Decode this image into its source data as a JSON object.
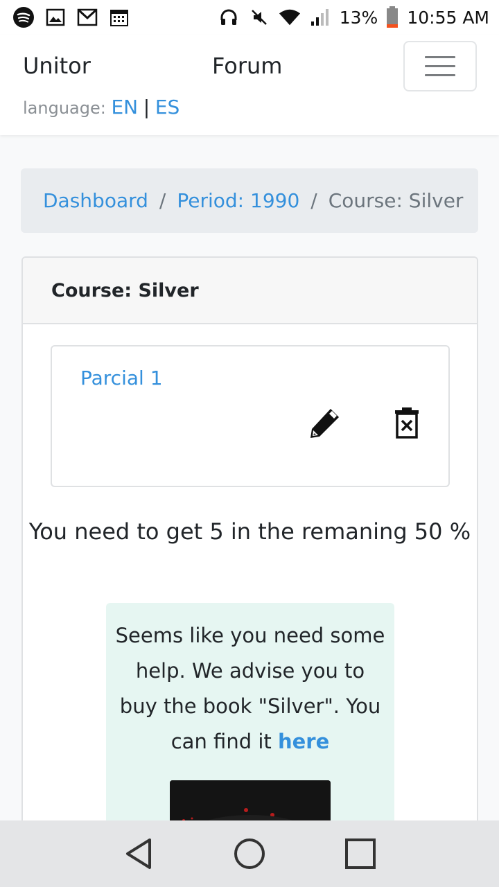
{
  "statusbar": {
    "battery": "13%",
    "time": "10:55 AM",
    "left_icons": [
      "spotify-icon",
      "gallery-icon",
      "gmail-icon",
      "calendar-icon"
    ],
    "right_icons": [
      "headset-icon",
      "mute-icon",
      "wifi-icon",
      "signal-icon",
      "battery-icon"
    ]
  },
  "navbar": {
    "brand": "Unitor",
    "forum": "Forum",
    "language_label": "language:",
    "lang_en": "EN",
    "lang_sep": "|",
    "lang_es": "ES"
  },
  "breadcrumb": {
    "items": [
      "Dashboard",
      "Period: 1990",
      "Course: Silver"
    ],
    "separator": "/"
  },
  "card": {
    "header": "Course: Silver",
    "partial": {
      "label": "Parcial 1",
      "edit_icon": "pencil-icon",
      "delete_icon": "delete-icon"
    },
    "need_text": "You need to get 5 in the remaning 50 %",
    "alert": {
      "text": "Seems like you need some help. We advise you to buy the book \"Silver\". You can find it",
      "link": "here"
    }
  },
  "colors": {
    "link": "#3490dc",
    "alert_bg": "#e6f6f2",
    "breadcrumb_bg": "#e9ecef"
  }
}
